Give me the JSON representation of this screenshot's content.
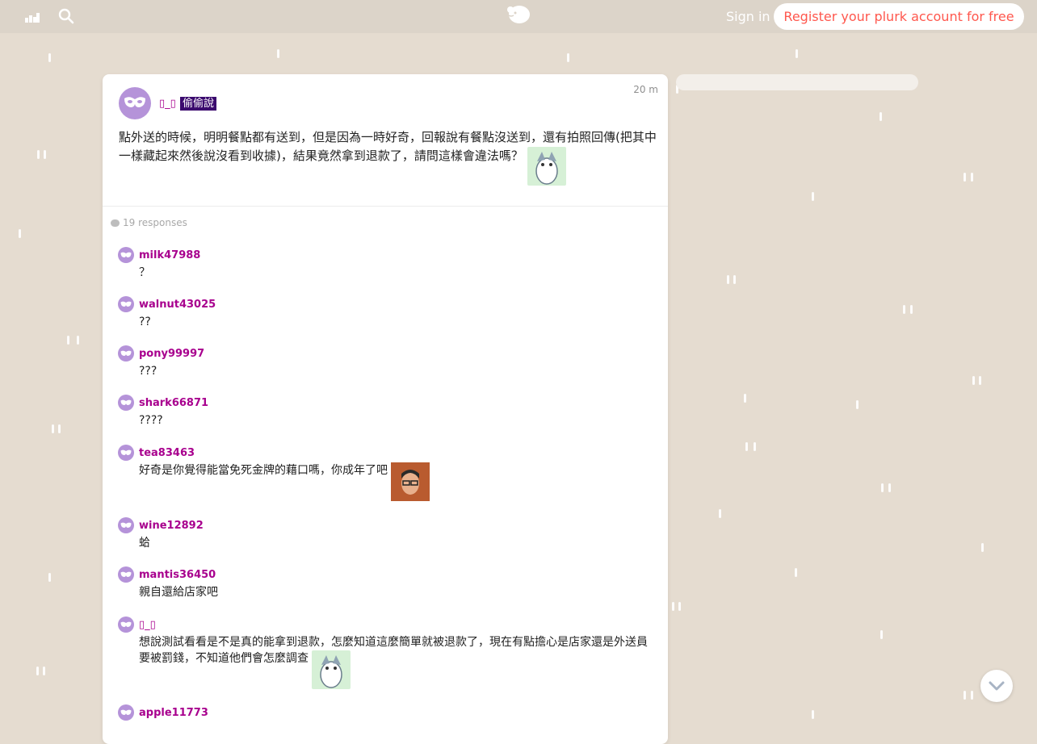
{
  "topbar": {
    "signin_label": "Sign in",
    "register_label": "Register your plurk account for free",
    "icons": [
      "stats-icon",
      "search-icon",
      "plurk-logo"
    ]
  },
  "post": {
    "time": "20 m",
    "author": "▯_▯",
    "qualifier": "偷偷說",
    "text": "點外送的時候，明明餐點都有送到，但是因為一時好奇，回報說有餐點沒送到，還有拍照回傳(把其中一樣藏起來然後說沒看到收據)，結果竟然拿到退款了，請問這樣會違法嗎？",
    "responses_label": "19 responses"
  },
  "responses": [
    {
      "name": "milk47988",
      "text": "？"
    },
    {
      "name": "walnut43025",
      "text": "??"
    },
    {
      "name": "pony99997",
      "text": "???"
    },
    {
      "name": "shark66871",
      "text": "????"
    },
    {
      "name": "tea83463",
      "text": "好奇是你覺得能當免死金牌的藉口嗎，你成年了吧"
    },
    {
      "name": "wine12892",
      "text": "蛤"
    },
    {
      "name": "mantis36450",
      "text": "親自還給店家吧"
    },
    {
      "name": "▯_▯",
      "text": "想說測試看看是不是真的能拿到退款，怎麼知道這麼簡單就被退款了，現在有點擔心是店家還是外送員要被罰錢，不知道他們會怎麼調查"
    },
    {
      "name": "apple11773",
      "text": ""
    }
  ],
  "colors": {
    "background": "#e5dcd0",
    "username": "#a8008e",
    "qualifier_bg": "#3b0a6e",
    "register_text": "#ff574d",
    "avatar": "#b593d9"
  }
}
